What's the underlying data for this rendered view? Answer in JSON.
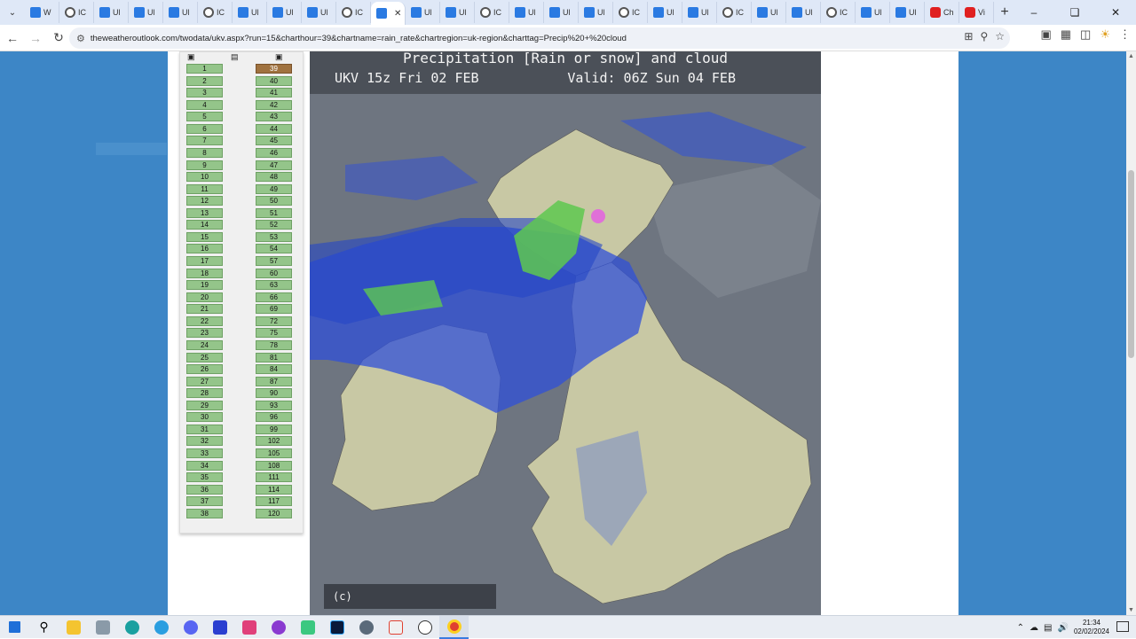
{
  "browser": {
    "tabs": [
      {
        "label": "W",
        "favicon": "weather-favicon"
      },
      {
        "label": "IC",
        "favicon": "globe-favicon"
      },
      {
        "label": "Ul",
        "favicon": "weather-favicon"
      },
      {
        "label": "Ul",
        "favicon": "weather-favicon"
      },
      {
        "label": "Ul",
        "favicon": "weather-favicon"
      },
      {
        "label": "IC",
        "favicon": "globe-favicon"
      },
      {
        "label": "Ul",
        "favicon": "weather-favicon"
      },
      {
        "label": "Ul",
        "favicon": "weather-favicon"
      },
      {
        "label": "Ul",
        "favicon": "weather-favicon"
      },
      {
        "label": "IC",
        "favicon": "globe-favicon"
      },
      {
        "label": "",
        "favicon": "weather-favicon",
        "active": true
      },
      {
        "label": "Ul",
        "favicon": "weather-favicon"
      },
      {
        "label": "Ul",
        "favicon": "weather-favicon"
      },
      {
        "label": "IC",
        "favicon": "globe-favicon"
      },
      {
        "label": "Ul",
        "favicon": "weather-favicon"
      },
      {
        "label": "Ul",
        "favicon": "weather-favicon"
      },
      {
        "label": "Ul",
        "favicon": "weather-favicon"
      },
      {
        "label": "IC",
        "favicon": "globe-favicon"
      },
      {
        "label": "Ul",
        "favicon": "weather-favicon"
      },
      {
        "label": "Ul",
        "favicon": "weather-favicon"
      },
      {
        "label": "IC",
        "favicon": "globe-favicon"
      },
      {
        "label": "Ul",
        "favicon": "weather-favicon"
      },
      {
        "label": "Ul",
        "favicon": "weather-favicon"
      },
      {
        "label": "IC",
        "favicon": "globe-favicon"
      },
      {
        "label": "Ul",
        "favicon": "weather-favicon"
      },
      {
        "label": "Ul",
        "favicon": "weather-favicon"
      },
      {
        "label": "Ch",
        "favicon": "youtube-favicon"
      },
      {
        "label": "Vi",
        "favicon": "youtube-favicon"
      }
    ],
    "url": "theweatheroutlook.com/twodata/ukv.aspx?run=15&charthour=39&chartname=rain_rate&chartregion=uk-region&charttag=Precip%20+%20cloud"
  },
  "panel": {
    "run_hours": [
      "1",
      "2",
      "3",
      "4",
      "5",
      "6",
      "7",
      "8",
      "9",
      "10",
      "11",
      "12",
      "13",
      "14",
      "15",
      "16",
      "17",
      "18",
      "19",
      "20",
      "21",
      "22",
      "23",
      "24",
      "25",
      "26",
      "27",
      "28",
      "29",
      "30",
      "31",
      "32",
      "33",
      "34",
      "35",
      "36",
      "37",
      "38"
    ],
    "chart_hours": [
      "39",
      "40",
      "41",
      "42",
      "43",
      "44",
      "45",
      "46",
      "47",
      "48",
      "49",
      "50",
      "51",
      "52",
      "53",
      "54",
      "57",
      "60",
      "63",
      "66",
      "69",
      "72",
      "75",
      "78",
      "81",
      "84",
      "87",
      "90",
      "93",
      "96",
      "99",
      "102",
      "105",
      "108",
      "111",
      "114",
      "117",
      "120"
    ],
    "selected_hour": "39"
  },
  "map": {
    "title": "Precipitation [Rain or snow] and cloud",
    "run": "UKV 15z Fri 02 FEB",
    "valid": "Valid: 06Z Sun 04 FEB",
    "copyright": "(c) www.theweatheroutlook.com"
  },
  "taskbar": {
    "time": "21:34",
    "date": "02/02/2024"
  },
  "colors": {
    "page_bg": "#3d86c6",
    "cell_green": "#94c58a",
    "cell_selected": "#a0723f",
    "rain_blue": "#3050d8",
    "rain_green": "#5ec850",
    "land": "#c8c8a4",
    "sea": "#6e7580"
  }
}
